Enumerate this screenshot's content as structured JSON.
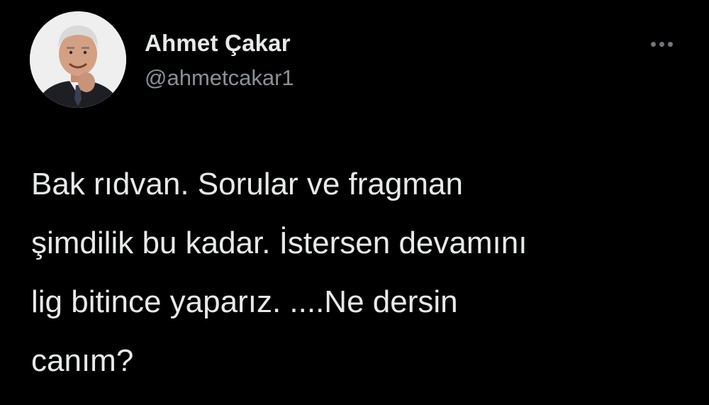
{
  "tweet": {
    "author": {
      "display_name": "Ahmet Çakar",
      "handle": "@ahmetcakar1",
      "avatar_icon": "profile-photo"
    },
    "more_icon": "more-horizontal-icon",
    "text_lines": [
      "Bak rıdvan. Sorular ve fragman",
      "şimdilik bu kadar. İstersen devamını",
      "lig bitince yaparız. ....Ne dersin",
      "canım?"
    ]
  },
  "colors": {
    "background": "#000000",
    "primary_text": "#e7e9ea",
    "secondary_text": "#8b9096"
  }
}
